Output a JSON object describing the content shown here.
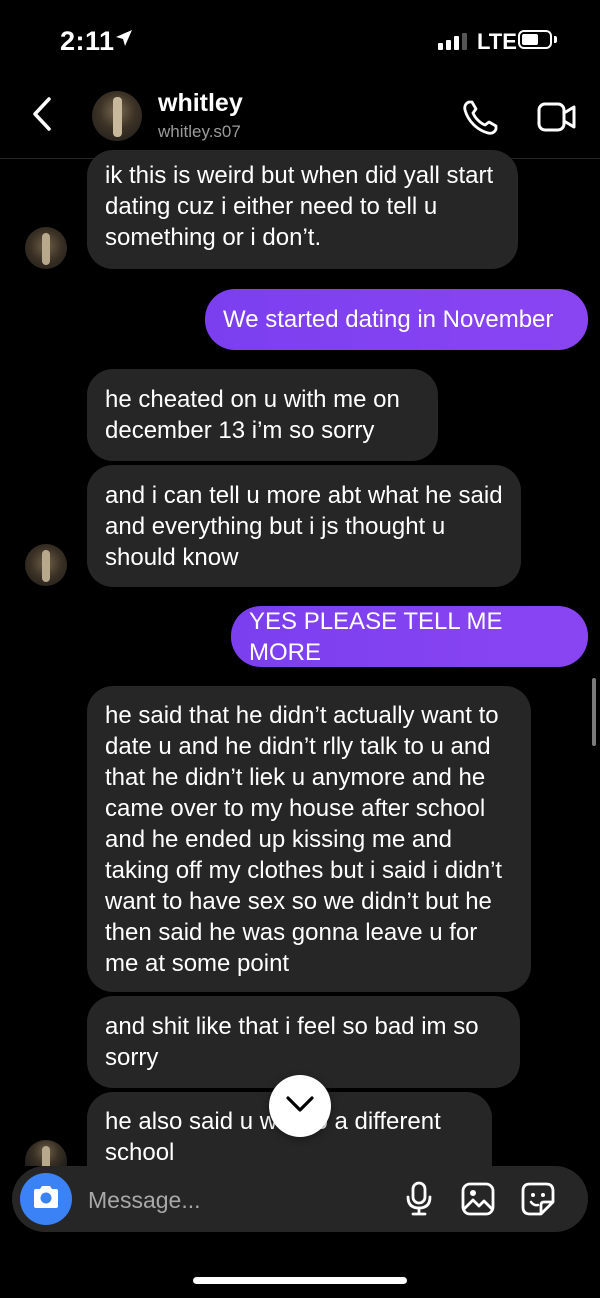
{
  "status_bar": {
    "time": "2:11",
    "network": "LTE",
    "icons": [
      "location-arrow-icon",
      "signal-icon",
      "battery-icon"
    ]
  },
  "header": {
    "contact_name": "whitley",
    "username": "whitley.s07",
    "icons": [
      "back-chevron-icon",
      "phone-icon",
      "video-camera-icon"
    ]
  },
  "messages": [
    {
      "direction": "received",
      "text": "ik this is weird but when did yall start dating cuz i either need to tell u something or i don’t."
    },
    {
      "direction": "sent",
      "text": "We started dating in November"
    },
    {
      "direction": "received",
      "text": "he cheated on u with me on december 13 i’m so sorry"
    },
    {
      "direction": "received",
      "text": "and i can tell u more abt what he said and everything but i js thought u should know"
    },
    {
      "direction": "sent",
      "text": "YES PLEASE TELL ME MORE"
    },
    {
      "direction": "received",
      "text": "he said that he didn’t actually want to date u and he didn’t rlly talk to u and that he didn’t liek u anymore and he came over to my house after school and he ended up kissing me and taking off my clothes but i said i didn’t want to have sex so we didn’t but he then said he was gonna leave u for me at some point"
    },
    {
      "direction": "received",
      "text": "and shit like that i feel so bad im so sorry"
    },
    {
      "direction": "received",
      "text": "he also said u w… to a different school"
    }
  ],
  "composer": {
    "placeholder": "Message...",
    "icons": [
      "camera-icon",
      "microphone-icon",
      "gallery-icon",
      "sticker-icon"
    ]
  },
  "colors": {
    "background": "#000000",
    "received_bubble": "#262626",
    "sent_bubble": "#7c3aed",
    "camera_button": "#3b82f6"
  }
}
